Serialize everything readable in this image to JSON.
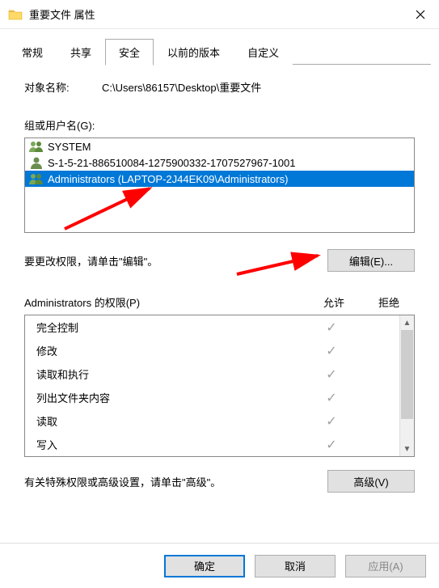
{
  "window": {
    "title": "重要文件 属性"
  },
  "tabs": {
    "general": "常规",
    "share": "共享",
    "security": "安全",
    "prev": "以前的版本",
    "custom": "自定义"
  },
  "object": {
    "label": "对象名称:",
    "path": "C:\\Users\\86157\\Desktop\\重要文件"
  },
  "groups": {
    "label": "组或用户名(G):",
    "items": [
      {
        "name": "SYSTEM",
        "icon": "group",
        "selected": false
      },
      {
        "name": "S-1-5-21-886510084-1275900332-1707527967-1001",
        "icon": "user",
        "selected": false
      },
      {
        "name": "Administrators (LAPTOP-2J44EK09\\Administrators)",
        "icon": "group",
        "selected": true
      }
    ]
  },
  "editRow": {
    "text": "要更改权限，请单击\"编辑\"。",
    "button": "编辑(E)..."
  },
  "permHeader": {
    "name": "Administrators 的权限(P)",
    "allow": "允许",
    "deny": "拒绝"
  },
  "permissions": [
    {
      "name": "完全控制",
      "allow": true,
      "deny": false
    },
    {
      "name": "修改",
      "allow": true,
      "deny": false
    },
    {
      "name": "读取和执行",
      "allow": true,
      "deny": false
    },
    {
      "name": "列出文件夹内容",
      "allow": true,
      "deny": false
    },
    {
      "name": "读取",
      "allow": true,
      "deny": false
    },
    {
      "name": "写入",
      "allow": true,
      "deny": false
    }
  ],
  "advRow": {
    "text": "有关特殊权限或高级设置，请单击\"高级\"。",
    "button": "高级(V)"
  },
  "footer": {
    "ok": "确定",
    "cancel": "取消",
    "apply": "应用(A)"
  }
}
